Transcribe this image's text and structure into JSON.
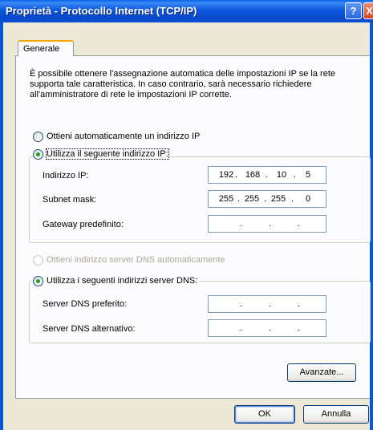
{
  "window": {
    "title": "Proprietà - Protocollo Internet (TCP/IP)",
    "help_glyph": "?",
    "close_glyph": "X"
  },
  "tabs": [
    {
      "label": "Generale"
    }
  ],
  "description": "È possibile ottenere l'assegnazione automatica delle impostazioni IP se la rete supporta tale caratteristica. In caso contrario, sarà necessario richiedere all'amministratore di rete le impostazioni IP corrette.",
  "ip": {
    "auto_label": "Ottieni automaticamente un indirizzo IP",
    "manual_label": "Utilizza il seguente indirizzo IP:",
    "selected": "manual",
    "fields": [
      {
        "label": "Indirizzo IP:",
        "octets": [
          "192",
          "168",
          "10",
          "5"
        ]
      },
      {
        "label": "Subnet mask:",
        "octets": [
          "255",
          "255",
          "255",
          "0"
        ]
      },
      {
        "label": "Gateway predefinito:",
        "octets": [
          "",
          "",
          "",
          ""
        ]
      }
    ]
  },
  "dns": {
    "auto_label": "Ottieni indirizzo server DNS automaticamente",
    "manual_label": "Utilizza i seguenti indirizzi server DNS:",
    "selected": "manual",
    "auto_disabled": true,
    "fields": [
      {
        "label": "Server DNS preferito:",
        "octets": [
          "",
          "",
          "",
          ""
        ]
      },
      {
        "label": "Server DNS alternativo:",
        "octets": [
          "",
          "",
          "",
          ""
        ]
      }
    ]
  },
  "buttons": {
    "advanced": "Avanzate...",
    "ok": "OK",
    "cancel": "Annulla"
  },
  "colors": {
    "titlebar": "#0a56d8",
    "dialog_bg": "#ece9d8",
    "radio_selected": "#21a121",
    "tab_highlight": "#f5a80e"
  }
}
